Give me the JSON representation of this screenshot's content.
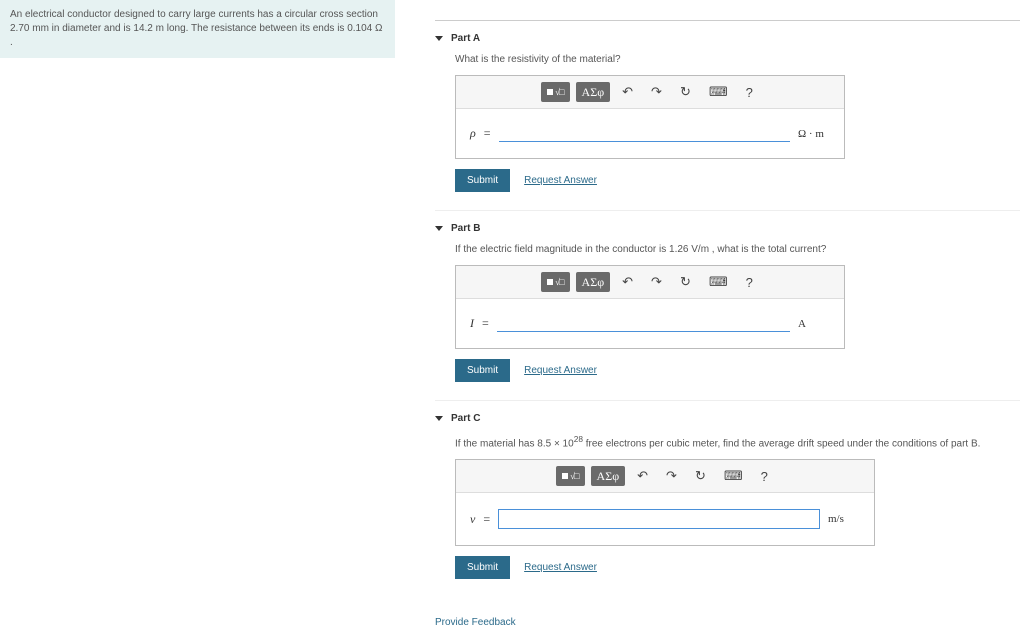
{
  "problem": {
    "text": "An electrical conductor designed to carry large currents has a circular cross section 2.70 mm in diameter and is 14.2 m long. The resistance between its ends is 0.104 Ω ."
  },
  "toolbar": {
    "greek": "ΑΣφ",
    "help": "?"
  },
  "parts": [
    {
      "title": "Part A",
      "question": "What is the resistivity of the material?",
      "var": "ρ",
      "unit": "Ω · m",
      "submit": "Submit",
      "request": "Request Answer",
      "boxed": false
    },
    {
      "title": "Part B",
      "question": "If the electric field magnitude in the conductor is 1.26 V/m , what is the total current?",
      "var": "I",
      "unit": "A",
      "submit": "Submit",
      "request": "Request Answer",
      "boxed": false
    },
    {
      "title": "Part C",
      "question_html": "If the material has 8.5 × 10<sup>28</sup> free electrons per cubic meter, find the average drift speed under the conditions of part B.",
      "question": "If the material has 8.5 × 10^28 free electrons per cubic meter, find the average drift speed under the conditions of part B.",
      "var": "v",
      "unit": "m/s",
      "submit": "Submit",
      "request": "Request Answer",
      "boxed": true
    }
  ],
  "feedback": "Provide Feedback"
}
